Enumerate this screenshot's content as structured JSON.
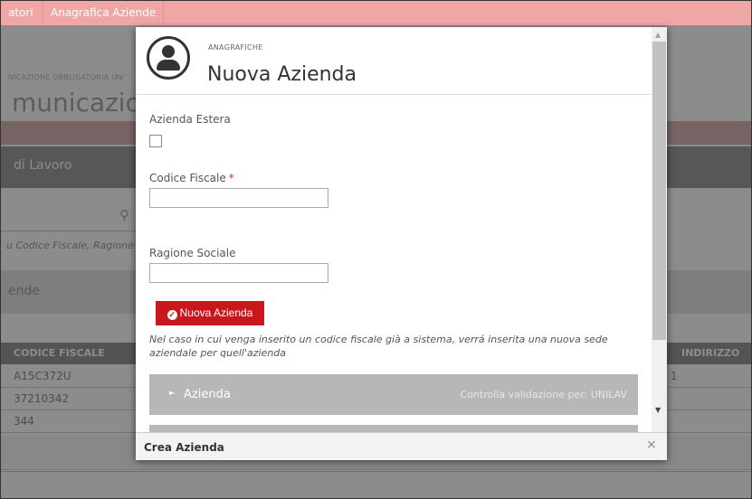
{
  "background": {
    "nav_tabs": [
      "atori",
      "Anagrafica Aziende"
    ],
    "breadcrumb": "NICAZIONE OBBLIGATORIA (AV",
    "page_title": "municazione",
    "section_title": "di Lavoro",
    "search_hint": "u Codice Fiscale, Ragione S",
    "aziende_label": "ende",
    "table": {
      "headers": [
        "CODICE FISCALE",
        "INDIRIZZO"
      ],
      "rows": [
        {
          "codice": "A15C372U",
          "right": "1"
        },
        {
          "codice": "37210342",
          "right": ""
        },
        {
          "codice": "344",
          "right": ""
        }
      ]
    }
  },
  "modal": {
    "kicker": "ANAGRAFICHE",
    "title": "Nuova Azienda",
    "estera_label": "Azienda Estera",
    "codice_label": "Codice Fiscale",
    "required_mark": "*",
    "codice_value": "",
    "ragione_label": "Ragione Sociale",
    "ragione_value": "",
    "new_button": "Nuova Azienda",
    "note": "Nel caso in cui venga inserito un codice fiscale già a sistema, verrá inserita una nuova sede aziendale per quell'azienda",
    "accordion": {
      "label": "Azienda",
      "value": "Controlla validazione per: UNILAV"
    },
    "footer_title": "Crea Azienda",
    "close_symbol": "×"
  },
  "icons": {
    "avatar": "user-circle-icon",
    "search": "search-icon",
    "check": "check-circle-icon"
  },
  "colors": {
    "nav_bar": "#efa7a6",
    "primary_button": "#c9171e",
    "accordion": "#b7b7b7"
  }
}
